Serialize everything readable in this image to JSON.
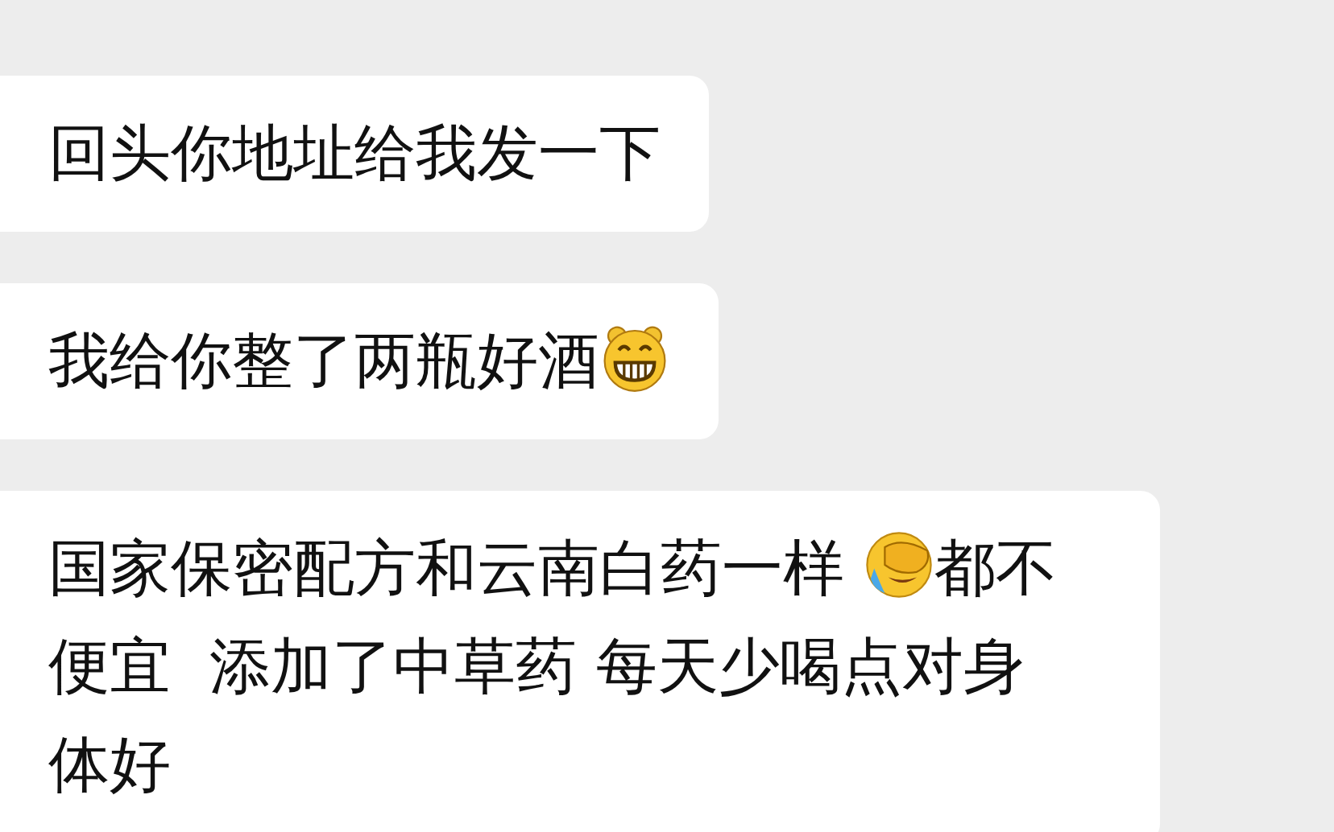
{
  "messages": [
    {
      "parts": [
        {
          "kind": "text",
          "text": "回头你地址给我发一下"
        }
      ]
    },
    {
      "parts": [
        {
          "kind": "text",
          "text": "我给你整了两瓶好酒"
        },
        {
          "kind": "grin-emoji"
        }
      ]
    },
    {
      "parts": [
        {
          "kind": "text",
          "text": "国家保密配方和云南白药一样 "
        },
        {
          "kind": "facepalm-emoji"
        },
        {
          "kind": "text",
          "text": "都不"
        },
        {
          "kind": "text",
          "text": "便宜  添加了中草药 每天少喝点对身"
        },
        {
          "kind": "text",
          "text": "体好"
        }
      ]
    }
  ]
}
